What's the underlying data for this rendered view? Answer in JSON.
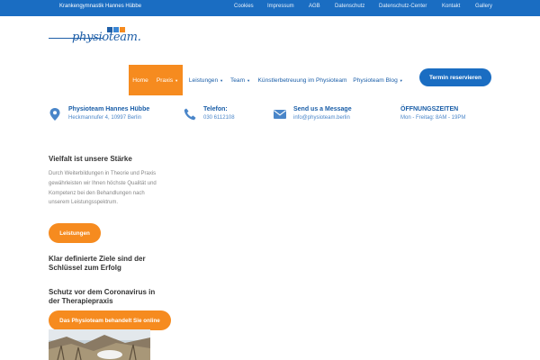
{
  "topbar": {
    "brand": "Krankengymnastik Hannes Hübbe",
    "links": [
      "Cookies",
      "Impressum",
      "AGB",
      "Datenschutz",
      "Datenschutz-Center",
      "Kontakt",
      "Gallery"
    ]
  },
  "logo": {
    "text_a": "physio",
    "text_b": "team."
  },
  "nav": {
    "items": [
      {
        "label": "Home"
      },
      {
        "label": "Praxis"
      },
      {
        "label": "Leistungen"
      },
      {
        "label": "Team"
      },
      {
        "label": "Künstlerbetreuung im Physioteam"
      },
      {
        "label": "Physioteam Blog"
      }
    ],
    "caret": "▼",
    "cta": "Termin reservieren"
  },
  "info": {
    "address": {
      "title": "Physioteam Hannes Hübbe",
      "sub": "Heckmannufer 4, 10997 Berlin"
    },
    "phone": {
      "title": "Telefon:",
      "sub": "030 6112108"
    },
    "message": {
      "title": "Send us a Message",
      "sub": "info@physioteam.berlin"
    },
    "hours": {
      "title": "ÖFFNUNGSZEITEN",
      "sub": "Mon - Freitag: 8AM - 19PM"
    }
  },
  "content": {
    "section1_title": "Vielfalt ist unsere Stärke",
    "section1_text": "Durch Weiterbildungen in Theorie und Praxis gewährleisten wir Ihnen höchste Qualität und Kompetenz bei den Behandlungen nach unserem Leistungsspektrum.",
    "section1_button": "Leistungen",
    "section2_title": "Klar definierte Ziele sind der Schlüssel zum Erfolg",
    "section3_title": "Schutz vor dem Coronavirus in der Therapiepraxis",
    "section3_button": "Das Physioteam behandelt Sie online"
  },
  "colors": {
    "primary": "#1a6dc2",
    "accent": "#f68b1f",
    "link": "#1a5ea8"
  },
  "icons": {
    "address": "map-marker-icon",
    "phone": "phone-icon",
    "message": "envelope-icon"
  }
}
